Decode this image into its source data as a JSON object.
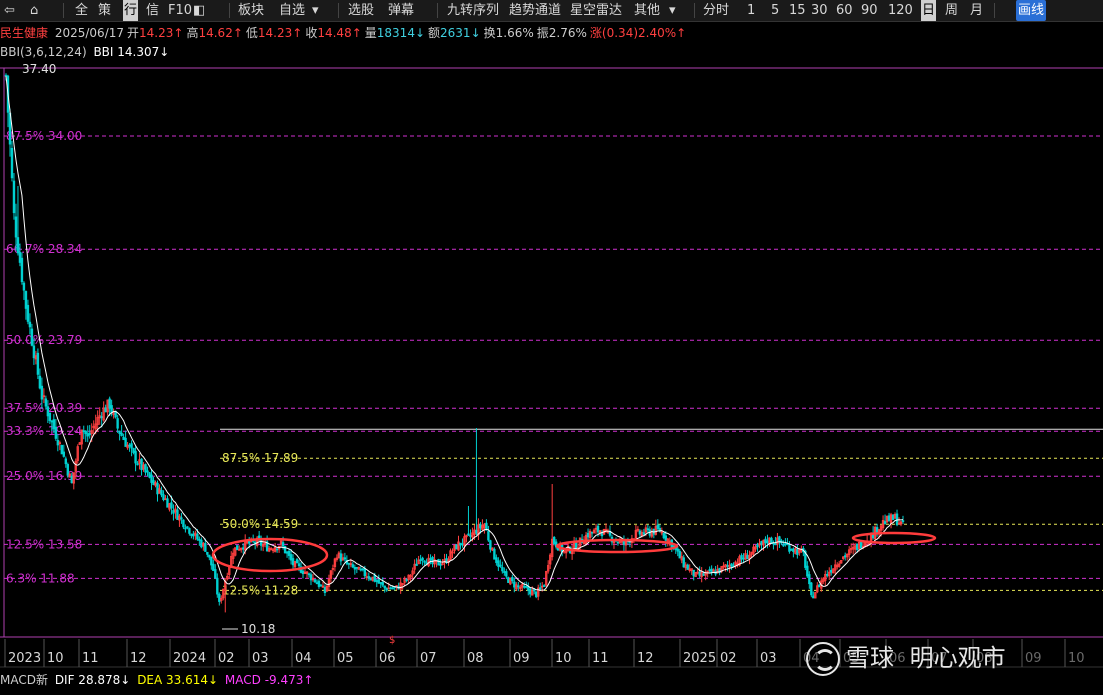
{
  "toolbar": {
    "items": [
      {
        "icon": "back-arrow-icon",
        "glyph": "⇦",
        "x": 4
      },
      {
        "icon": "home-icon",
        "glyph": "⌂",
        "x": 30
      },
      {
        "label": "全",
        "x": 75
      },
      {
        "label": "策",
        "x": 98
      },
      {
        "label": "行",
        "x": 123,
        "selected": true
      },
      {
        "label": "信",
        "x": 146
      },
      {
        "label": "F10",
        "x": 168
      },
      {
        "icon": "layout-icon",
        "glyph": "◧",
        "x": 193
      },
      {
        "label": "板块",
        "x": 238
      },
      {
        "label": "自选",
        "x": 279
      },
      {
        "icon": "chevron-down-icon",
        "glyph": "▾",
        "x": 312
      },
      {
        "label": "选股",
        "x": 348
      },
      {
        "label": "弹幕",
        "x": 388
      },
      {
        "label": "九转序列",
        "x": 447
      },
      {
        "label": "趋势通道",
        "x": 509
      },
      {
        "label": "星空雷达",
        "x": 570
      },
      {
        "label": "其他",
        "x": 634
      },
      {
        "icon": "chevron-down-icon",
        "glyph": "▾",
        "x": 669
      },
      {
        "label": "分时",
        "x": 703
      },
      {
        "label": "1",
        "x": 747
      },
      {
        "label": "5",
        "x": 771
      },
      {
        "label": "15",
        "x": 789
      },
      {
        "label": "30",
        "x": 811
      },
      {
        "label": "60",
        "x": 836
      },
      {
        "label": "90",
        "x": 861
      },
      {
        "label": "120",
        "x": 888
      },
      {
        "label": "日",
        "x": 921,
        "selected": true
      },
      {
        "label": "周",
        "x": 945
      },
      {
        "label": "月",
        "x": 970
      },
      {
        "label": "画线",
        "x": 1016,
        "blue": true
      }
    ]
  },
  "info": {
    "name": "民生健康",
    "date": "2025/06/17",
    "open_label": "开",
    "open": "14.23↑",
    "high_label": "高",
    "high": "14.62↑",
    "low_label": "低",
    "low": "14.23↑",
    "close_label": "收",
    "close": "14.48↑",
    "vol_label": "量",
    "vol": "18314↓",
    "amt_label": "额",
    "amt": "2631↓",
    "turn_label": "换",
    "turn": "1.66%",
    "amp_label": "振",
    "amp": "2.76%",
    "chg_label": "涨",
    "chg": "(0.34)2.40%↑"
  },
  "bbi": {
    "name": "BBI(3,6,12,24)",
    "value": "BBI 14.307↓"
  },
  "macd": {
    "name": "MACD新",
    "dif": "DIF 28.878↓",
    "dea": "DEA 33.614↓",
    "macd": "MACD -9.473↑"
  },
  "watermark": {
    "brand": "雪球",
    "author": "明心观市"
  },
  "colors": {
    "up": "#ff4040",
    "down": "#00d0d0",
    "fib_long": "#d030d0",
    "fib_short": "#e8e858",
    "ellipse": "#ff3c3c",
    "bbi": "#ffffff",
    "axis": "#b040b0"
  },
  "chart_data": {
    "type": "candlestick",
    "ylim": [
      9.0,
      37.4
    ],
    "high_label": "37.40",
    "low_label": "10.18",
    "fib_long": [
      {
        "label": "87.5% 34.00",
        "price": 34.0
      },
      {
        "label": "66.7% 28.34",
        "price": 28.34
      },
      {
        "label": "50.0% 23.79",
        "price": 23.79
      },
      {
        "label": "37.5% 20.39",
        "price": 20.39
      },
      {
        "label": "33.3% 19.24",
        "price": 19.24
      },
      {
        "label": "25.0% 16.99",
        "price": 16.99
      },
      {
        "label": "12.5% 13.58",
        "price": 13.58
      },
      {
        "label": "6.3% 11.88",
        "price": 11.88
      }
    ],
    "fib_short": [
      {
        "label": "87.5% 17.89",
        "price": 17.89
      },
      {
        "label": "50.0% 14.59",
        "price": 14.59
      },
      {
        "label": "12.5% 11.28",
        "price": 11.28
      }
    ],
    "x_ticks": [
      "2023",
      "10",
      "11",
      "12",
      "2024",
      "02",
      "03",
      "04",
      "05",
      "06",
      "07",
      "08",
      "09",
      "10",
      "11",
      "12",
      "2025",
      "02",
      "03",
      "04",
      "05",
      "06",
      "07",
      "08",
      "09",
      "10"
    ],
    "anchors": [
      [
        0,
        37.0
      ],
      [
        4,
        30.0
      ],
      [
        10,
        25.5
      ],
      [
        18,
        21.0
      ],
      [
        28,
        18.3
      ],
      [
        33,
        16.6
      ],
      [
        38,
        19.5
      ],
      [
        41,
        18.9
      ],
      [
        48,
        20.2
      ],
      [
        52,
        20.6
      ],
      [
        56,
        19.4
      ],
      [
        64,
        18.0
      ],
      [
        74,
        16.6
      ],
      [
        84,
        15.3
      ],
      [
        93,
        14.2
      ],
      [
        100,
        13.4
      ],
      [
        104,
        12.3
      ],
      [
        107,
        10.6
      ],
      [
        110,
        11.8
      ],
      [
        114,
        13.3
      ],
      [
        120,
        13.6
      ],
      [
        126,
        13.7
      ],
      [
        132,
        13.4
      ],
      [
        138,
        13.6
      ],
      [
        144,
        12.6
      ],
      [
        150,
        12.2
      ],
      [
        156,
        11.7
      ],
      [
        160,
        11.2
      ],
      [
        166,
        13.1
      ],
      [
        172,
        12.5
      ],
      [
        178,
        12.2
      ],
      [
        184,
        11.9
      ],
      [
        190,
        11.4
      ],
      [
        196,
        11.4
      ],
      [
        202,
        11.9
      ],
      [
        208,
        13.0
      ],
      [
        214,
        12.6
      ],
      [
        220,
        12.7
      ],
      [
        226,
        13.5
      ],
      [
        232,
        13.9
      ],
      [
        236,
        14.3
      ],
      [
        240,
        14.6
      ],
      [
        244,
        13.2
      ],
      [
        250,
        12.0
      ],
      [
        256,
        11.5
      ],
      [
        262,
        11.3
      ],
      [
        266,
        11.1
      ],
      [
        270,
        11.6
      ],
      [
        274,
        13.8
      ],
      [
        280,
        13.2
      ],
      [
        286,
        13.5
      ],
      [
        292,
        14.1
      ],
      [
        298,
        14.3
      ],
      [
        304,
        13.9
      ],
      [
        310,
        13.6
      ],
      [
        316,
        14.1
      ],
      [
        322,
        14.2
      ],
      [
        328,
        14.3
      ],
      [
        334,
        13.6
      ],
      [
        340,
        12.6
      ],
      [
        346,
        12.0
      ],
      [
        352,
        12.1
      ],
      [
        358,
        12.3
      ],
      [
        364,
        12.6
      ],
      [
        370,
        12.9
      ],
      [
        376,
        13.3
      ],
      [
        382,
        13.8
      ],
      [
        388,
        13.7
      ],
      [
        394,
        13.4
      ],
      [
        400,
        13.1
      ],
      [
        404,
        10.9
      ],
      [
        410,
        11.9
      ],
      [
        418,
        12.8
      ],
      [
        426,
        13.4
      ],
      [
        434,
        14.0
      ],
      [
        440,
        14.7
      ],
      [
        446,
        14.9
      ],
      [
        450,
        14.5
      ]
    ],
    "spikes": [
      [
        110,
        10.18
      ],
      [
        236,
        19.4
      ],
      [
        274,
        16.6
      ],
      [
        6,
        31.5
      ],
      [
        52,
        20.0
      ],
      [
        232,
        15.5
      ]
    ],
    "ellipses": [
      {
        "cx": 270,
        "cy": 555,
        "rx": 57,
        "ry": 16
      },
      {
        "cx": 617,
        "cy": 546,
        "rx": 60,
        "ry": 6
      },
      {
        "cx": 894,
        "cy": 538,
        "rx": 41,
        "ry": 5
      }
    ]
  }
}
